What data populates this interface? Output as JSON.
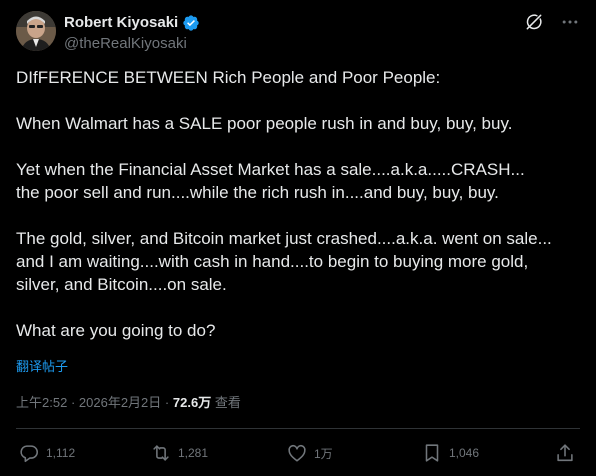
{
  "author": {
    "display_name": "Robert Kiyosaki",
    "handle": "@theRealKiyosaki"
  },
  "icons": {
    "avatar": "profile-photo",
    "verified": "verified-badge-icon",
    "grok": "grok-icon",
    "more": "more-icon",
    "reply": "reply-icon",
    "retweet": "retweet-icon",
    "like": "like-icon",
    "bookmark": "bookmark-icon",
    "share": "share-icon"
  },
  "tweet": {
    "paragraphs": [
      "DIfFERENCE BETWEEN Rich People and Poor People:",
      "When Walmart has a SALE poor people rush in and buy, buy, buy.",
      "Yet when the Financial Asset Market has  a sale....a.k.a.....CRASH...\nthe poor sell and run....while the rich rush in....and buy, buy, buy.",
      "The gold, silver, and Bitcoin market just  crashed....a.k.a. went on sale...\nand I am waiting....with cash in hand....to begin to buying more gold,\nsilver, and Bitcoin....on sale.",
      "What are you going to do?"
    ],
    "translate_label": "翻译帖子"
  },
  "meta": {
    "time": "上午2:52",
    "separator": "·",
    "date": "2026年2月2日",
    "views_count": "72.6万",
    "views_label": "查看"
  },
  "stats": {
    "replies": "1,112",
    "retweets": "1,281",
    "likes": "1万",
    "bookmarks": "1,046"
  },
  "colors": {
    "background": "#000000",
    "text": "#e7e9ea",
    "secondary": "#71767b",
    "accent": "#1d9bf0",
    "divider": "#2f3336"
  }
}
